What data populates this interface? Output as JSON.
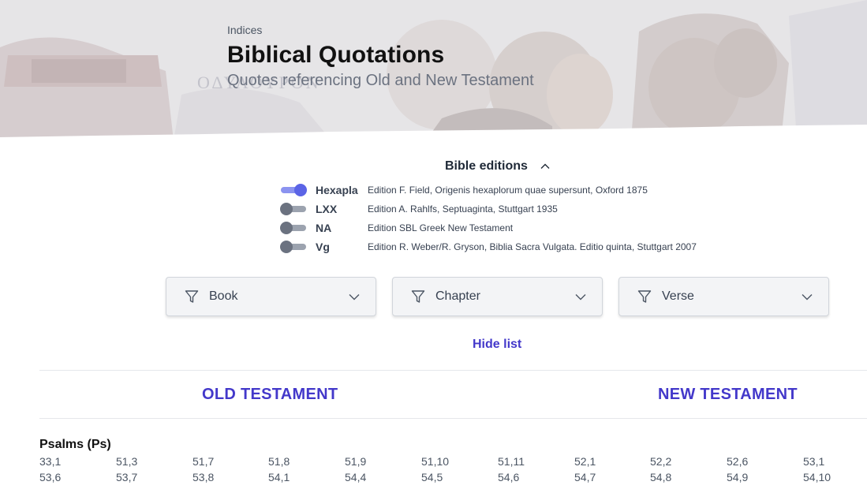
{
  "hero": {
    "eyebrow": "Indices",
    "title": "Biblical Quotations",
    "subtitle": "Quotes referencing Old and New Testament"
  },
  "editions": {
    "heading": "Bible editions",
    "items": [
      {
        "abbr": "Hexapla",
        "description": "Edition F. Field, Origenis hexaplorum quae supersunt, Oxford 1875",
        "enabled": true
      },
      {
        "abbr": "LXX",
        "description": "Edition A. Rahlfs, Septuaginta, Stuttgart 1935",
        "enabled": false
      },
      {
        "abbr": "NA",
        "description": "Edition SBL Greek New Testament",
        "enabled": false
      },
      {
        "abbr": "Vg",
        "description": "Edition R. Weber/R. Gryson, Biblia Sacra Vulgata. Editio quinta, Stuttgart 2007",
        "enabled": false
      }
    ]
  },
  "filters": {
    "book": "Book",
    "chapter": "Chapter",
    "verse": "Verse"
  },
  "hide_list": "Hide list",
  "testaments": {
    "old": "OLD TESTAMENT",
    "new": "NEW TESTAMENT"
  },
  "book": {
    "name": "Psalms (Ps)",
    "rows": [
      [
        "33,1",
        "51,3",
        "51,7",
        "51,8",
        "51,9",
        "51,10",
        "51,11",
        "52,1",
        "52,2",
        "52,6",
        "53,1"
      ],
      [
        "53,6",
        "53,7",
        "53,8",
        "54,1",
        "54,4",
        "54,5",
        "54,6",
        "54,7",
        "54,8",
        "54,9",
        "54,10"
      ]
    ]
  },
  "colors": {
    "accent": "#4338ca",
    "toggle_on": "#5b64e6",
    "toggle_off": "#6b7280"
  }
}
